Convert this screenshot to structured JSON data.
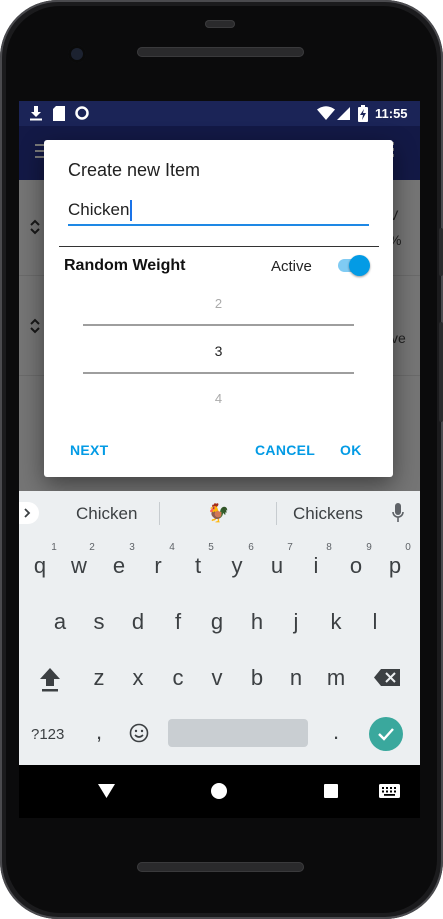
{
  "status_bar": {
    "time": "11:55",
    "left_icons": [
      "download-icon",
      "sd-card-icon",
      "circle-icon"
    ],
    "right_icons": [
      "wifi-icon",
      "cellular-signal-icon",
      "battery-charging-icon"
    ]
  },
  "background_list": {
    "row1_right_fragments": [
      "V",
      "%"
    ],
    "row2_right_fragments": [
      "ve"
    ]
  },
  "dialog": {
    "title": "Create new Item",
    "name_value": "Chicken",
    "section_label": "Random Weight",
    "toggle_label": "Active",
    "toggle_on": true,
    "picker": {
      "above": "2",
      "selected": "3",
      "below": "4"
    },
    "buttons": {
      "next": "NEXT",
      "cancel": "CANCEL",
      "ok": "OK"
    }
  },
  "keyboard": {
    "suggestions": [
      "Chicken",
      "🐓",
      "Chickens"
    ],
    "row1": [
      "q",
      "w",
      "e",
      "r",
      "t",
      "y",
      "u",
      "i",
      "o",
      "p"
    ],
    "row1_hints": [
      "1",
      "2",
      "3",
      "4",
      "5",
      "6",
      "7",
      "8",
      "9",
      "0"
    ],
    "row2": [
      "a",
      "s",
      "d",
      "f",
      "g",
      "h",
      "j",
      "k",
      "l"
    ],
    "row3": [
      "z",
      "x",
      "c",
      "v",
      "b",
      "n",
      "m"
    ],
    "symbols_key": "?123",
    "comma_key": ",",
    "period_key": "."
  },
  "colors": {
    "primary": "#283593",
    "status_bar": "#1b2457",
    "accent": "#039be5",
    "enter_key": "#3aa89d"
  }
}
